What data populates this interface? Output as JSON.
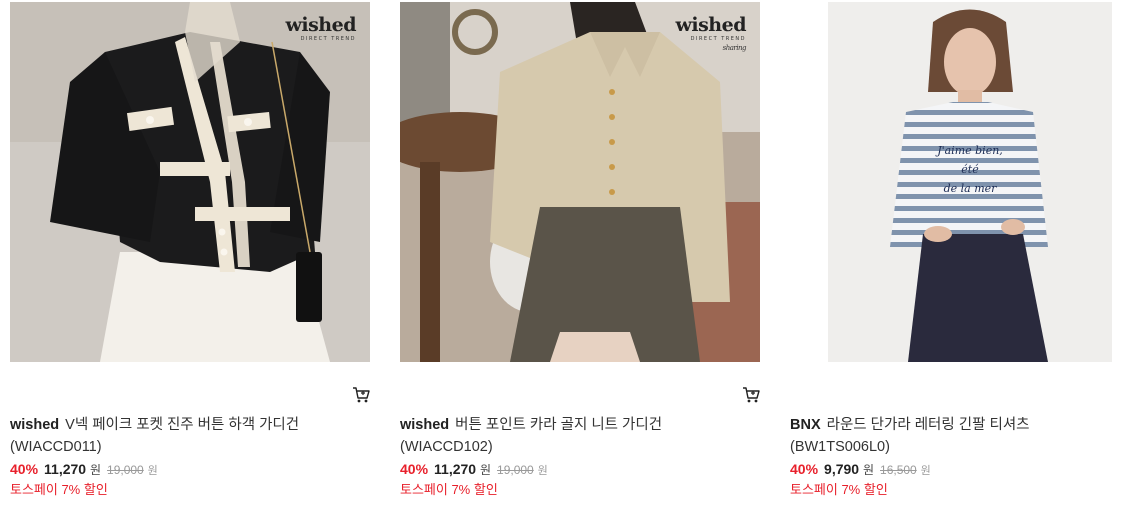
{
  "products": [
    {
      "logo": "wished",
      "logo_sub": "DIRECT TREND",
      "logo_tag": "",
      "brand": "wished",
      "name": "V넥 페이크 포켓 진주 버튼 하객 가디건",
      "code": "(WIACCD011)",
      "discount": "40%",
      "price": "11,270",
      "currency": "원",
      "original_price": "19,000",
      "original_currency": "원",
      "promo": "토스페이 7% 할인",
      "has_cart": true
    },
    {
      "logo": "wished",
      "logo_sub": "DIRECT TREND",
      "logo_tag": "sharing",
      "brand": "wished",
      "name": "버튼 포인트 카라 골지 니트 가디건",
      "code": "(WIACCD102)",
      "discount": "40%",
      "price": "11,270",
      "currency": "원",
      "original_price": "19,000",
      "original_currency": "원",
      "promo": "토스페이 7% 할인",
      "has_cart": true
    },
    {
      "logo": "",
      "logo_sub": "",
      "logo_tag": "",
      "brand": "BNX",
      "name": "라운드 단가라 레터링 긴팔 티셔츠",
      "code": "(BW1TS006L0)",
      "discount": "40%",
      "price": "9,790",
      "currency": "원",
      "original_price": "16,500",
      "original_currency": "원",
      "promo": "토스페이 7% 할인",
      "has_cart": false,
      "shirt_print": [
        "J'aime bien,",
        "été",
        "de la mer"
      ]
    }
  ],
  "colors": {
    "discount": "#e8202b",
    "promo": "#e8202b",
    "strikethrough": "#9a9a9a"
  },
  "icons": {
    "cart": "shopping-cart-icon"
  }
}
